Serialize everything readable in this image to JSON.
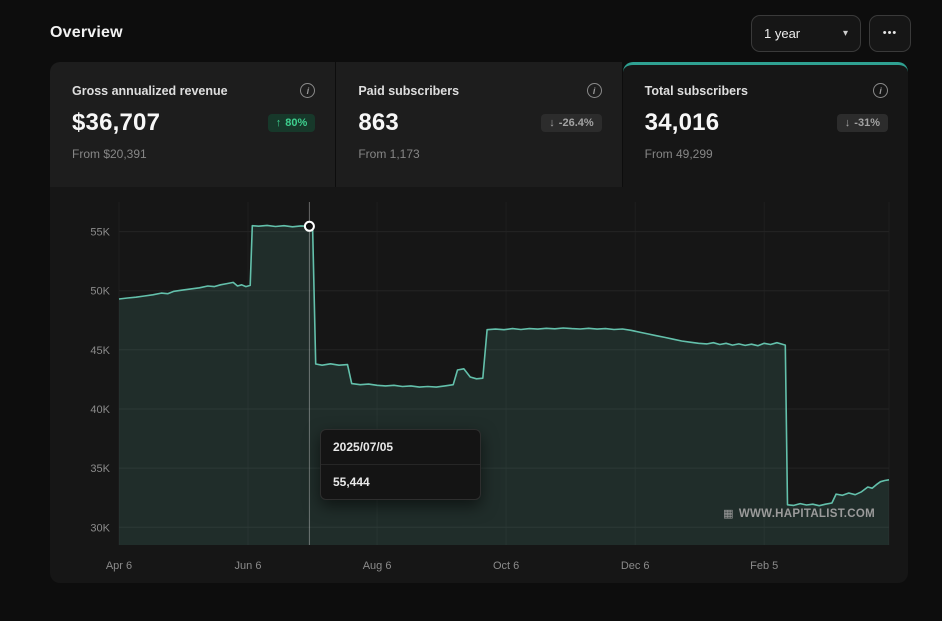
{
  "header": {
    "title": "Overview",
    "range_value": "1 year"
  },
  "icons": {
    "info": "i",
    "arrow_up": "↑",
    "arrow_down": "↓",
    "caret": "▾",
    "more": "•••",
    "logo": "▦"
  },
  "cards": [
    {
      "title": "Gross annualized revenue",
      "value": "$36,707",
      "delta": "80%",
      "delta_dir": "up",
      "from": "From $20,391"
    },
    {
      "title": "Paid subscribers",
      "value": "863",
      "delta": "-26.4%",
      "delta_dir": "down",
      "from": "From 1,173"
    },
    {
      "title": "Total subscribers",
      "value": "34,016",
      "delta": "-31%",
      "delta_dir": "down",
      "from": "From 49,299"
    }
  ],
  "tooltip": {
    "date": "2025/07/05",
    "value": "55,444"
  },
  "watermark": {
    "text": "WWW.HAPITALIST.COM"
  },
  "chart_data": {
    "type": "area",
    "title": "Total subscribers",
    "x_tick_labels": [
      "Apr 6",
      "Jun 6",
      "Aug 6",
      "Oct 6",
      "Dec 6",
      "Feb 5"
    ],
    "x_tick_days": [
      0,
      61,
      122,
      183,
      244,
      305
    ],
    "x_range_days": [
      0,
      364
    ],
    "y_tick_labels": [
      "30K",
      "35K",
      "40K",
      "45K",
      "50K",
      "55K"
    ],
    "y_tick_values": [
      30000,
      35000,
      40000,
      45000,
      50000,
      55000
    ],
    "ylim": [
      28500,
      57500
    ],
    "grid": true,
    "legend": "none",
    "marker": {
      "day": 90,
      "value": 55444,
      "date": "2025/07/05"
    },
    "colors": {
      "line": "#63c0ab",
      "fill": "rgba(99,192,171,0.14)",
      "grid": "#242424",
      "tick_text": "#8b8b8b"
    },
    "series": [
      {
        "name": "Total subscribers",
        "points": [
          [
            0,
            49300
          ],
          [
            4,
            49380
          ],
          [
            8,
            49450
          ],
          [
            12,
            49550
          ],
          [
            16,
            49650
          ],
          [
            20,
            49800
          ],
          [
            23,
            49750
          ],
          [
            26,
            49950
          ],
          [
            30,
            50050
          ],
          [
            34,
            50150
          ],
          [
            38,
            50250
          ],
          [
            42,
            50400
          ],
          [
            45,
            50350
          ],
          [
            48,
            50500
          ],
          [
            51,
            50600
          ],
          [
            54,
            50700
          ],
          [
            56,
            50400
          ],
          [
            58,
            50500
          ],
          [
            60,
            50350
          ],
          [
            62,
            50450
          ],
          [
            63,
            55500
          ],
          [
            66,
            55450
          ],
          [
            70,
            55520
          ],
          [
            74,
            55430
          ],
          [
            78,
            55500
          ],
          [
            82,
            55400
          ],
          [
            86,
            55480
          ],
          [
            90,
            55444
          ],
          [
            91.5,
            55400
          ],
          [
            93,
            43800
          ],
          [
            96,
            43700
          ],
          [
            100,
            43820
          ],
          [
            104,
            43700
          ],
          [
            108,
            43750
          ],
          [
            110,
            42150
          ],
          [
            114,
            42050
          ],
          [
            118,
            42100
          ],
          [
            122,
            42000
          ],
          [
            126,
            41950
          ],
          [
            130,
            42000
          ],
          [
            134,
            41900
          ],
          [
            138,
            41950
          ],
          [
            142,
            41850
          ],
          [
            146,
            41900
          ],
          [
            150,
            41850
          ],
          [
            154,
            41950
          ],
          [
            158,
            42050
          ],
          [
            160,
            43300
          ],
          [
            163,
            43400
          ],
          [
            166,
            42700
          ],
          [
            169,
            42550
          ],
          [
            172,
            42600
          ],
          [
            174,
            46700
          ],
          [
            178,
            46750
          ],
          [
            182,
            46700
          ],
          [
            186,
            46800
          ],
          [
            190,
            46720
          ],
          [
            194,
            46800
          ],
          [
            198,
            46750
          ],
          [
            202,
            46820
          ],
          [
            206,
            46780
          ],
          [
            210,
            46850
          ],
          [
            214,
            46800
          ],
          [
            218,
            46760
          ],
          [
            222,
            46820
          ],
          [
            226,
            46750
          ],
          [
            230,
            46800
          ],
          [
            234,
            46720
          ],
          [
            238,
            46760
          ],
          [
            242,
            46650
          ],
          [
            246,
            46500
          ],
          [
            250,
            46350
          ],
          [
            254,
            46200
          ],
          [
            258,
            46050
          ],
          [
            262,
            45900
          ],
          [
            266,
            45750
          ],
          [
            270,
            45650
          ],
          [
            274,
            45550
          ],
          [
            278,
            45500
          ],
          [
            281,
            45600
          ],
          [
            284,
            45450
          ],
          [
            287,
            45550
          ],
          [
            290,
            45400
          ],
          [
            293,
            45500
          ],
          [
            296,
            45380
          ],
          [
            299,
            45480
          ],
          [
            302,
            45350
          ],
          [
            305,
            45550
          ],
          [
            308,
            45450
          ],
          [
            311,
            45600
          ],
          [
            313,
            45500
          ],
          [
            315,
            45400
          ],
          [
            316,
            31900
          ],
          [
            319,
            31850
          ],
          [
            322,
            32000
          ],
          [
            325,
            31880
          ],
          [
            328,
            31950
          ],
          [
            331,
            31820
          ],
          [
            334,
            31950
          ],
          [
            337,
            32050
          ],
          [
            339,
            32800
          ],
          [
            342,
            32700
          ],
          [
            345,
            32900
          ],
          [
            348,
            32750
          ],
          [
            351,
            33000
          ],
          [
            354,
            33400
          ],
          [
            356,
            33300
          ],
          [
            358,
            33600
          ],
          [
            360,
            33850
          ],
          [
            362,
            33950
          ],
          [
            364,
            34016
          ]
        ]
      }
    ]
  }
}
